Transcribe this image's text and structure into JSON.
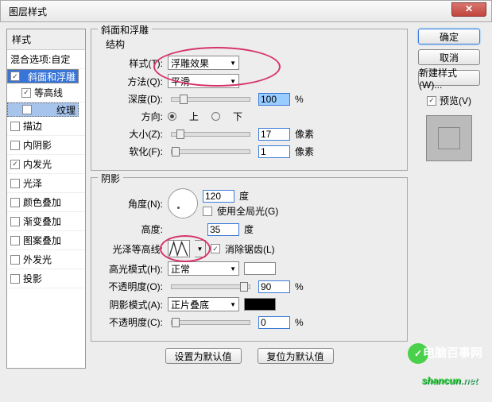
{
  "title": "图层样式",
  "sidebar": {
    "header": "样式",
    "blend": "混合选项:自定",
    "items": [
      {
        "label": "斜面和浮雕",
        "on": true,
        "sel": true
      },
      {
        "label": "等高线",
        "on": true,
        "sel": false,
        "sub": true
      },
      {
        "label": "纹理",
        "on": false,
        "sel": true,
        "sub": true
      },
      {
        "label": "描边",
        "on": false
      },
      {
        "label": "内阴影",
        "on": false
      },
      {
        "label": "内发光",
        "on": true
      },
      {
        "label": "光泽",
        "on": false
      },
      {
        "label": "颜色叠加",
        "on": false
      },
      {
        "label": "渐变叠加",
        "on": false
      },
      {
        "label": "图案叠加",
        "on": false
      },
      {
        "label": "外发光",
        "on": false
      },
      {
        "label": "投影",
        "on": false
      }
    ]
  },
  "main": {
    "group_title": "斜面和浮雕",
    "structure": {
      "title": "结构",
      "style_lbl": "样式(T):",
      "style_val": "浮雕效果",
      "tech_lbl": "方法(Q):",
      "tech_val": "平滑",
      "depth_lbl": "深度(D):",
      "depth_val": "100",
      "depth_unit": "%",
      "dir_lbl": "方向:",
      "up": "上",
      "down": "下",
      "size_lbl": "大小(Z):",
      "size_val": "17",
      "size_unit": "像素",
      "soft_lbl": "软化(F):",
      "soft_val": "1",
      "soft_unit": "像素"
    },
    "shading": {
      "title": "阴影",
      "angle_lbl": "角度(N):",
      "angle_val": "120",
      "angle_unit": "度",
      "global_lbl": "使用全局光(G)",
      "alt_lbl": "高度:",
      "alt_val": "35",
      "alt_unit": "度",
      "gloss_lbl": "光泽等高线:",
      "aa_lbl": "消除锯齿(L)",
      "hmode_lbl": "高光模式(H):",
      "hmode_val": "正常",
      "hop_lbl": "不透明度(O):",
      "hop_val": "90",
      "hop_unit": "%",
      "smode_lbl": "阴影模式(A):",
      "smode_val": "正片叠底",
      "sop_lbl": "不透明度(C):",
      "sop_val": "0",
      "sop_unit": "%"
    },
    "defaults_btn": "设置为默认值",
    "reset_btn": "复位为默认值"
  },
  "right": {
    "ok": "确定",
    "cancel": "取消",
    "new_style": "新建样式(W)...",
    "preview": "预览(V)"
  },
  "watermark": {
    "brand": "shancun",
    "suffix": ".net",
    "top": "电脑百事网"
  }
}
